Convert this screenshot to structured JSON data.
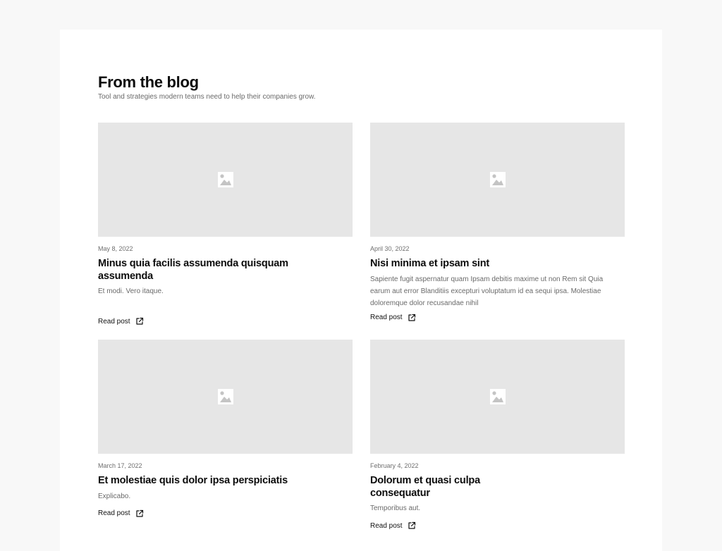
{
  "header": {
    "title": "From the blog",
    "subtitle": "Tool and strategies modern teams need to help their companies grow."
  },
  "posts": [
    {
      "date": "May 8, 2022",
      "title": "Minus quia facilis assumenda quisquam assumenda",
      "excerpt": "Et modi. Vero itaque.",
      "link_label": "Read post",
      "image_icon": "image-placeholder-icon",
      "link_icon": "external-link-icon"
    },
    {
      "date": "April 30, 2022",
      "title": "Nisi minima et ipsam sint",
      "excerpt": "Sapiente fugit aspernatur quam Ipsam debitis maxime ut non Rem sit Quia earum aut error Blanditiis excepturi voluptatum id ea sequi ipsa. Molestiae doloremque dolor recusandae nihil",
      "link_label": "Read post",
      "image_icon": "image-placeholder-icon",
      "link_icon": "external-link-icon"
    },
    {
      "date": "March 17, 2022",
      "title": "Et molestiae quis dolor ipsa perspiciatis",
      "excerpt": "Explicabo.",
      "link_label": "Read post",
      "image_icon": "image-placeholder-icon",
      "link_icon": "external-link-icon"
    },
    {
      "date": "February 4, 2022",
      "title": "Dolorum et quasi culpa consequatur",
      "excerpt": "Temporibus aut.",
      "link_label": "Read post",
      "image_icon": "image-placeholder-icon",
      "link_icon": "external-link-icon"
    }
  ],
  "colors": {
    "page_background": "#f8f8f8",
    "card_background": "#ffffff",
    "placeholder_background": "#e6e6e6",
    "placeholder_icon": "#c4c4c4",
    "heading_text": "#0c0c0c",
    "muted_text": "#6a6a6a"
  }
}
